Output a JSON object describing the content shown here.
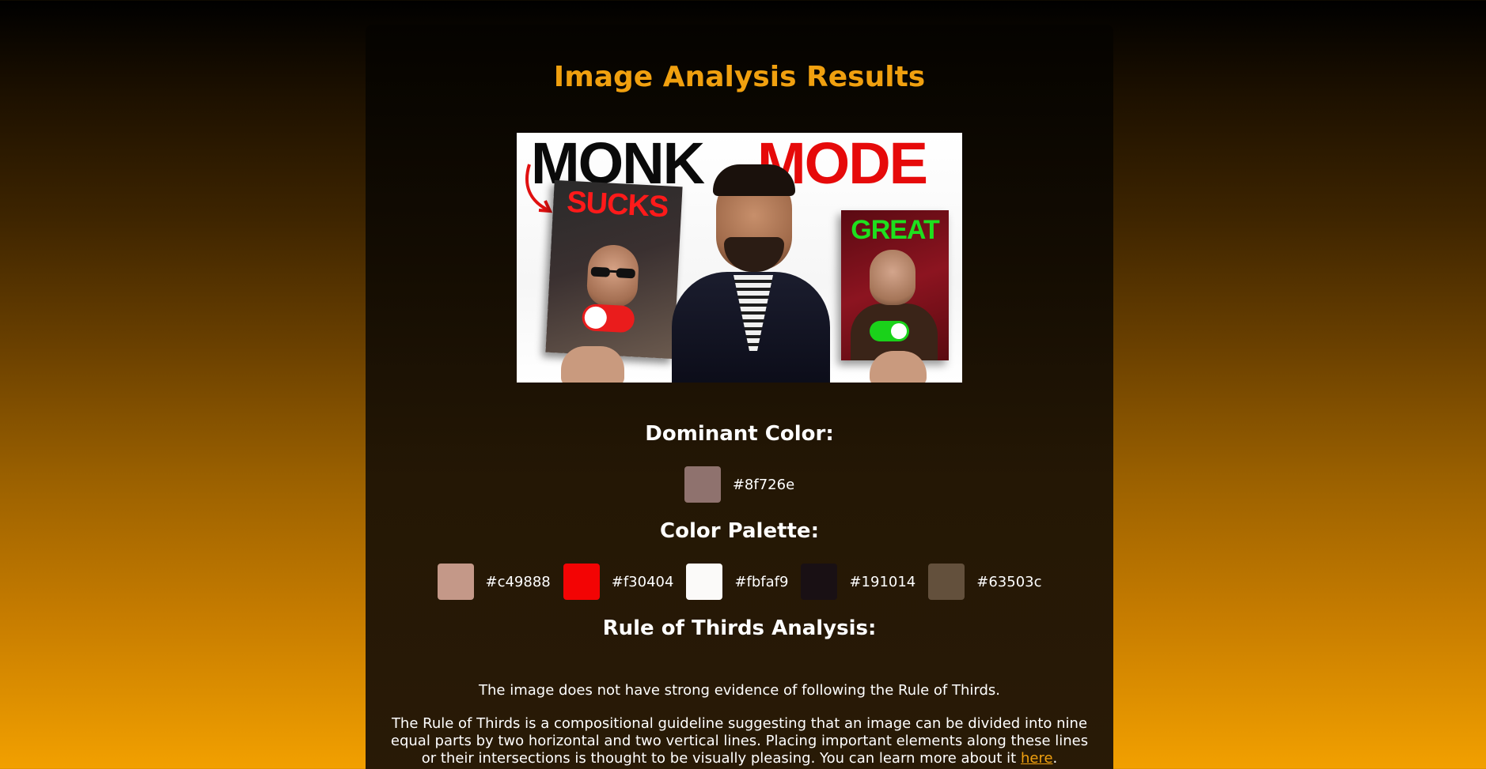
{
  "header": {
    "title": "Image Analysis Results"
  },
  "thumbnail": {
    "headline_word_1": "MONK",
    "headline_word_2": "MODE",
    "left_book_label": "SUCKS",
    "right_book_label": "GREAT"
  },
  "dominant": {
    "heading": "Dominant Color:",
    "color": "#8f726e",
    "label": "#8f726e"
  },
  "palette": {
    "heading": "Color Palette:",
    "colors": [
      {
        "color": "#c49888",
        "label": "#c49888"
      },
      {
        "color": "#f30404",
        "label": "#f30404"
      },
      {
        "color": "#fbfaf9",
        "label": "#fbfaf9"
      },
      {
        "color": "#191014",
        "label": "#191014"
      },
      {
        "color": "#63503c",
        "label": "#63503c"
      }
    ]
  },
  "rule_of_thirds": {
    "heading": "Rule of Thirds Analysis:",
    "result": "The image does not have strong evidence of following the Rule of Thirds.",
    "info": "The Rule of Thirds is a compositional guideline suggesting that an image can be divided into nine equal parts by two horizontal and two vertical lines. Placing important elements along these lines or their intersections is thought to be visually pleasing. You can learn more about it ",
    "link_text": "here",
    "trailing": "."
  },
  "colors": {
    "accent": "#f0a00f",
    "card_bg": "#1a1004"
  }
}
